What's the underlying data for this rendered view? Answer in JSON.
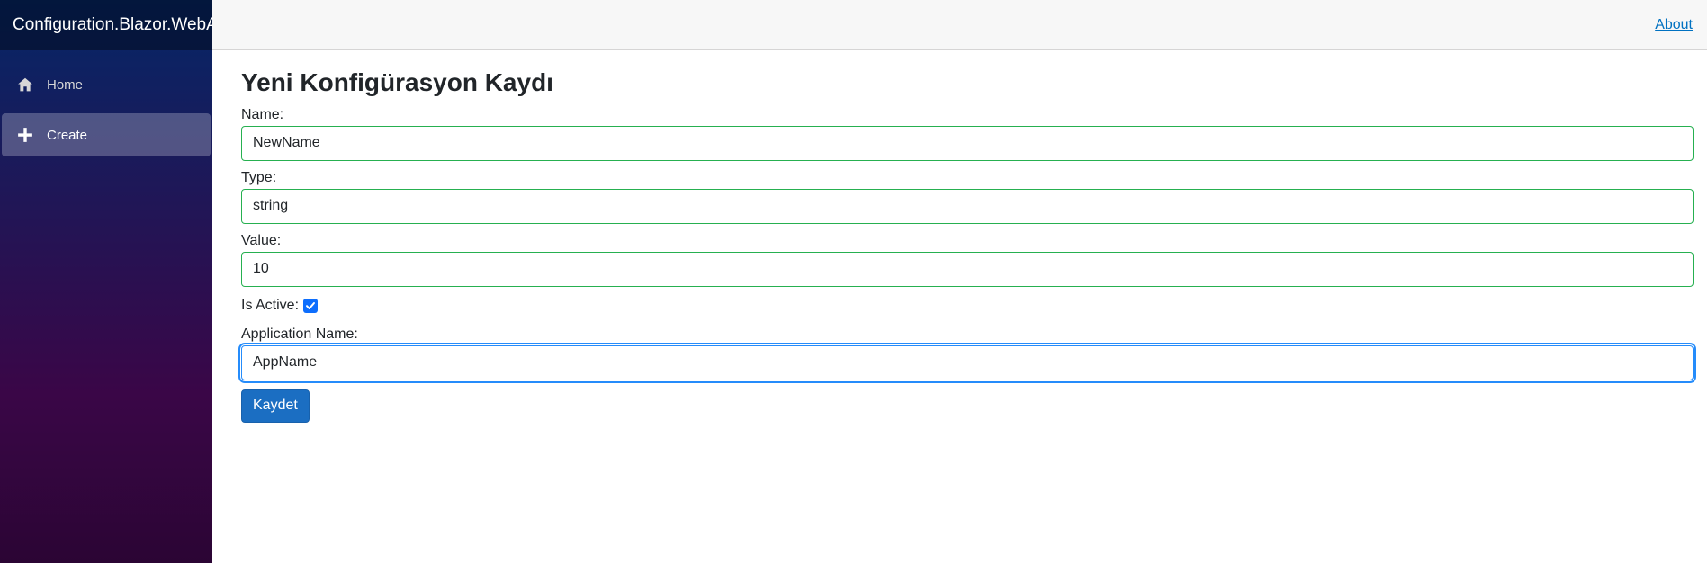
{
  "app": {
    "brand": "Configuration.Blazor.WebApp"
  },
  "sidebar": {
    "items": [
      {
        "label": "Home",
        "icon": "home-icon",
        "active": false
      },
      {
        "label": "Create",
        "icon": "plus-icon",
        "active": true
      }
    ]
  },
  "topbar": {
    "about_label": "About"
  },
  "page": {
    "title": "Yeni Konfigürasyon Kaydı",
    "fields": {
      "name": {
        "label": "Name:",
        "value": "NewName"
      },
      "type": {
        "label": "Type:",
        "value": "string"
      },
      "value": {
        "label": "Value:",
        "value": "10"
      },
      "is_active": {
        "label": "Is Active:",
        "checked": true
      },
      "application_name": {
        "label": "Application Name:",
        "value": "AppName"
      }
    },
    "save_label": "Kaydet"
  },
  "colors": {
    "sidebar_top": "#052767",
    "sidebar_bottom": "#3a0647",
    "valid_border": "#26b050",
    "focus_border": "#258cfb",
    "button": "#1b6ec2",
    "link": "#0071c1"
  }
}
